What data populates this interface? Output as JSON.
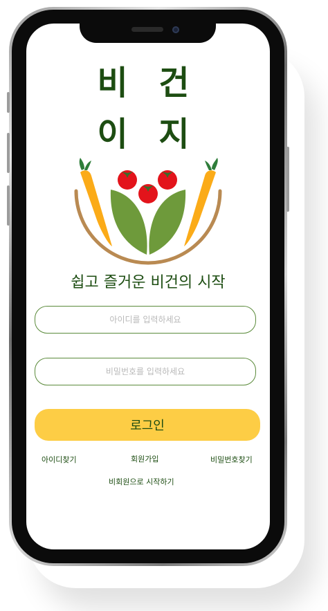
{
  "app": {
    "title_line1": "비 건",
    "title_line2": "이 지",
    "tagline": "쉽고 즐거운 비건의 시작"
  },
  "login_form": {
    "id_placeholder": "아이디를 입력하세요",
    "password_placeholder": "비밀번호를 입력하세요",
    "login_label": "로그인"
  },
  "links": {
    "find_id": "아이디찾기",
    "sign_up": "회원가입",
    "find_password": "비밀번호찾기",
    "guest_start": "비회원으로 시작하기"
  },
  "colors": {
    "brand_green": "#1d4d12",
    "button_yellow": "#fdcd45",
    "field_border": "#5a8a3a",
    "carrot_orange": "#fbab18",
    "tomato_red": "#e3141b",
    "leaf_green": "#6e9a3b",
    "bowl_brown": "#b98a52"
  },
  "icons": {
    "logo": "vegetable-bowl-logo"
  }
}
